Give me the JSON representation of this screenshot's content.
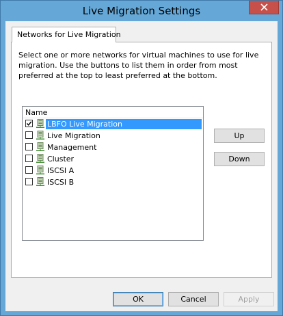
{
  "window": {
    "title": "Live Migration Settings"
  },
  "tab": {
    "label": "Networks for Live Migration"
  },
  "description": "Select one or more networks for virtual machines to use for live migration. Use the buttons to list them in order from most preferred at the top to least preferred at the bottom.",
  "list": {
    "header": "Name",
    "items": [
      {
        "label": "LBFO Live Migration",
        "checked": true,
        "selected": true,
        "icon": "network-adapter-icon"
      },
      {
        "label": "Live Migration",
        "checked": false,
        "selected": false,
        "icon": "network-adapter-icon"
      },
      {
        "label": "Management",
        "checked": false,
        "selected": false,
        "icon": "network-adapter-icon"
      },
      {
        "label": "Cluster",
        "checked": false,
        "selected": false,
        "icon": "network-adapter-icon"
      },
      {
        "label": "ISCSI A",
        "checked": false,
        "selected": false,
        "icon": "network-adapter-icon"
      },
      {
        "label": "ISCSI B",
        "checked": false,
        "selected": false,
        "icon": "network-adapter-icon"
      }
    ]
  },
  "buttons": {
    "up": "Up",
    "down": "Down",
    "ok": "OK",
    "cancel": "Cancel",
    "apply": "Apply"
  },
  "colors": {
    "frame": "#65a8d8",
    "close": "#c7504a",
    "selection": "#3399ff"
  }
}
